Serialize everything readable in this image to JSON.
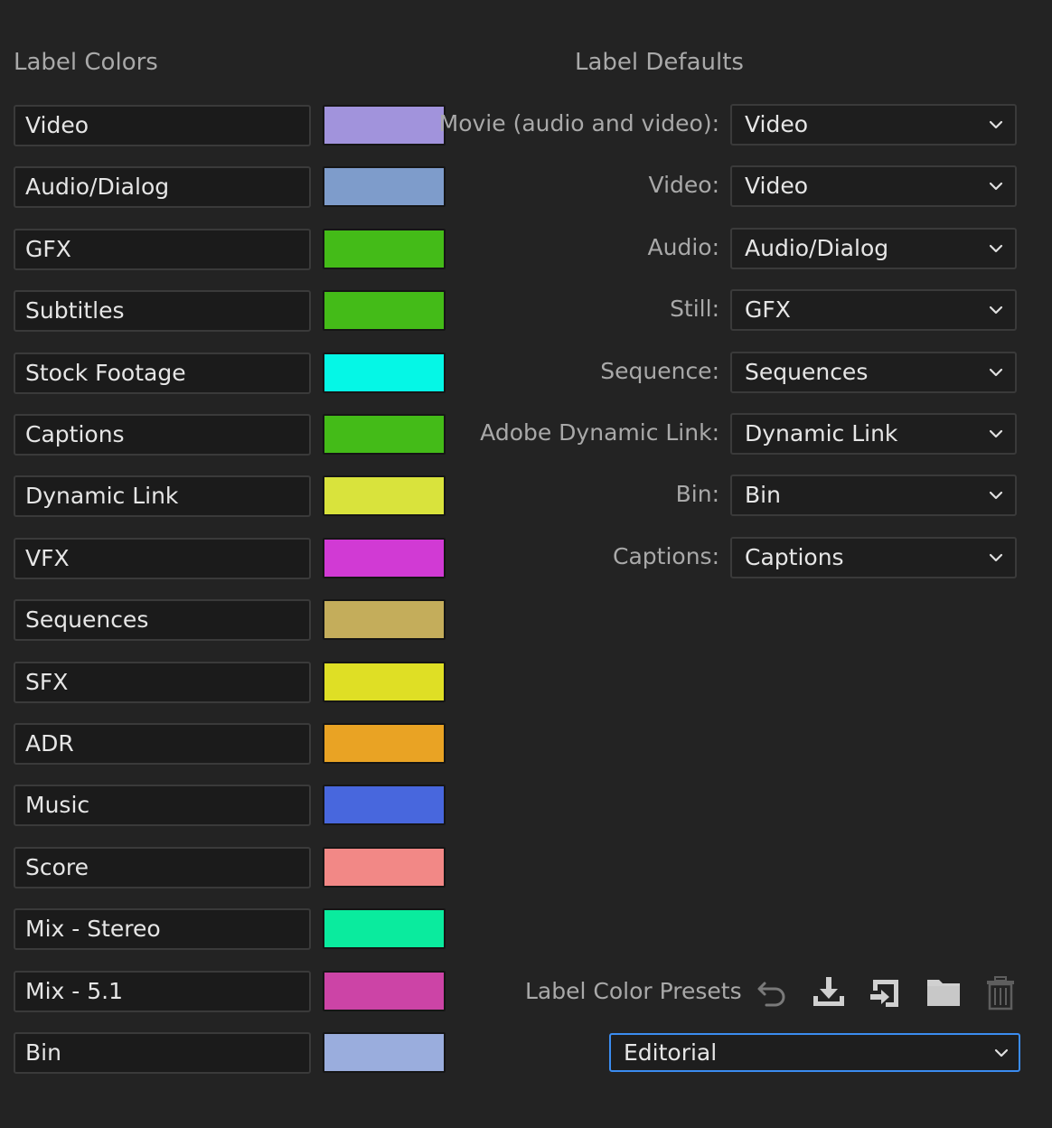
{
  "label_colors": {
    "title": "Label Colors",
    "items": [
      {
        "name": "Video",
        "color": "#a193dc"
      },
      {
        "name": "Audio/Dialog",
        "color": "#7e9ccb"
      },
      {
        "name": "GFX",
        "color": "#44bb18"
      },
      {
        "name": "Subtitles",
        "color": "#44bb18"
      },
      {
        "name": "Stock Footage",
        "color": "#05f7e6"
      },
      {
        "name": "Captions",
        "color": "#44bb18"
      },
      {
        "name": "Dynamic Link",
        "color": "#d9e33c"
      },
      {
        "name": "VFX",
        "color": "#d13ad4"
      },
      {
        "name": "Sequences",
        "color": "#c4ad5b"
      },
      {
        "name": "SFX",
        "color": "#dfdf25"
      },
      {
        "name": "ADR",
        "color": "#e9a324"
      },
      {
        "name": "Music",
        "color": "#4867dd"
      },
      {
        "name": "Score",
        "color": "#f28886"
      },
      {
        "name": "Mix - Stereo",
        "color": "#0aeb9e"
      },
      {
        "name": "Mix - 5.1",
        "color": "#cc44a6"
      },
      {
        "name": "Bin",
        "color": "#9aaddd"
      }
    ]
  },
  "label_defaults": {
    "title": "Label Defaults",
    "items": [
      {
        "label": "Movie (audio and video):",
        "value": "Video"
      },
      {
        "label": "Video:",
        "value": "Video"
      },
      {
        "label": "Audio:",
        "value": "Audio/Dialog"
      },
      {
        "label": "Still:",
        "value": "GFX"
      },
      {
        "label": "Sequence:",
        "value": "Sequences"
      },
      {
        "label": "Adobe Dynamic Link:",
        "value": "Dynamic Link"
      },
      {
        "label": "Bin:",
        "value": "Bin"
      },
      {
        "label": "Captions:",
        "value": "Captions"
      }
    ]
  },
  "presets": {
    "label": "Label Color Presets",
    "selected": "Editorial",
    "icons": [
      "undo-icon",
      "import-icon",
      "export-icon",
      "folder-icon",
      "trash-icon"
    ],
    "focus_color": "#3b8cf0"
  }
}
